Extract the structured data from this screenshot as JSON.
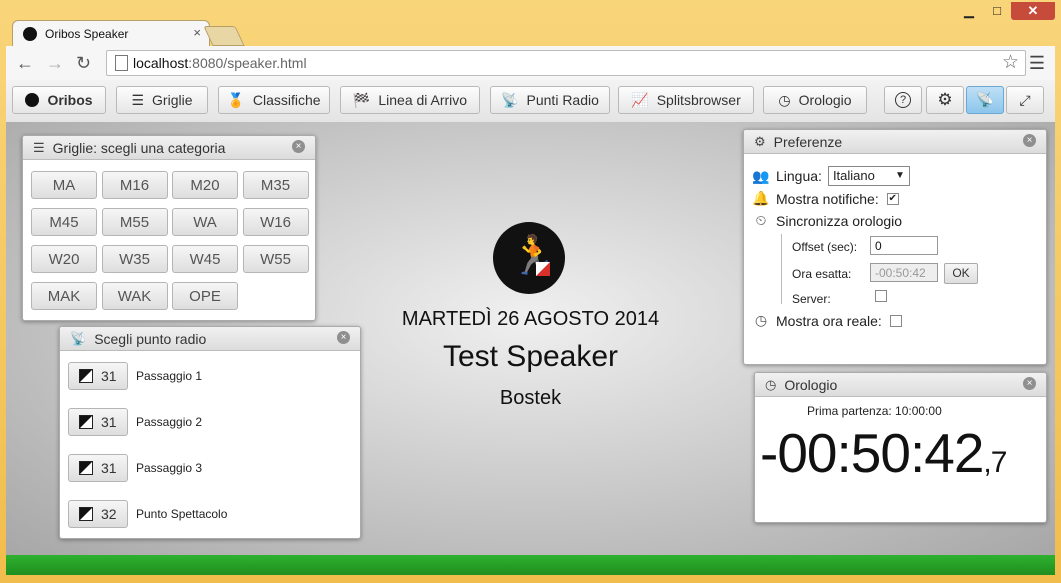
{
  "browser": {
    "tab_title": "Oribos Speaker",
    "url_host": "localhost",
    "url_rest": ":8080/speaker.html"
  },
  "toolbar": {
    "brand": "Oribos",
    "items": [
      {
        "label": "Griglie",
        "icon": "list-icon"
      },
      {
        "label": "Classifiche",
        "icon": "medal-icon"
      },
      {
        "label": "Linea di Arrivo",
        "icon": "checkered-flag-icon"
      },
      {
        "label": "Punti Radio",
        "icon": "antenna-icon"
      },
      {
        "label": "Splitsbrowser",
        "icon": "chart-icon"
      },
      {
        "label": "Orologio",
        "icon": "clock-icon"
      }
    ],
    "right_icons": [
      "help-icon",
      "gear-icon",
      "satellite-icon",
      "fullscreen-icon"
    ],
    "active_right": "satellite-icon"
  },
  "center": {
    "date": "MARTEDÌ 26 AGOSTO 2014",
    "event": "Test Speaker",
    "organizer": "Bostek"
  },
  "grids_panel": {
    "title": "Griglie: scegli una categoria",
    "categories": [
      "MA",
      "M16",
      "M20",
      "M35",
      "M45",
      "M55",
      "WA",
      "W16",
      "W20",
      "W35",
      "W45",
      "W55",
      "MAK",
      "WAK",
      "OPE"
    ]
  },
  "radio_panel": {
    "title": "Scegli punto radio",
    "points": [
      {
        "code": "31",
        "name": "Passaggio 1"
      },
      {
        "code": "31",
        "name": "Passaggio 2"
      },
      {
        "code": "31",
        "name": "Passaggio 3"
      },
      {
        "code": "32",
        "name": "Punto Spettacolo"
      }
    ]
  },
  "prefs_panel": {
    "title": "Preferenze",
    "language_label": "Lingua:",
    "language_value": "Italiano",
    "notifications_label": "Mostra notifiche:",
    "notifications_checked": true,
    "sync_label": "Sincronizza orologio",
    "offset_label": "Offset (sec):",
    "offset_value": "0",
    "exact_time_label": "Ora esatta:",
    "exact_time_value": "-00:50:42",
    "ok_label": "OK",
    "server_label": "Server:",
    "real_time_label": "Mostra ora reale:"
  },
  "clock_panel": {
    "title": "Orologio",
    "first_start_label": "Prima partenza:",
    "first_start_value": "10:00:00",
    "time_main": "-00:50:42",
    "time_tenths": ",7"
  }
}
